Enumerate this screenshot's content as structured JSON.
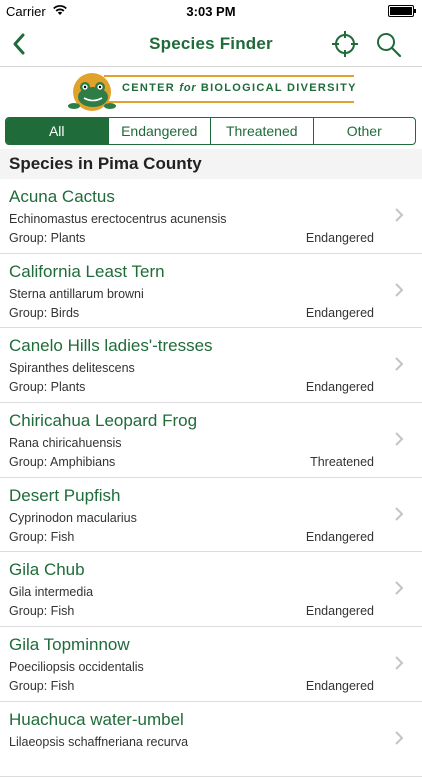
{
  "status_bar": {
    "carrier": "Carrier",
    "time": "3:03 PM"
  },
  "nav": {
    "title": "Species Finder"
  },
  "logo": {
    "text_prefix": "CENTER",
    "text_for": "for",
    "text_suffix": "BIOLOGICAL DIVERSITY"
  },
  "filter": {
    "options": [
      "All",
      "Endangered",
      "Threatened",
      "Other"
    ],
    "selected": "All"
  },
  "section": {
    "title": "Species in Pima County"
  },
  "species": [
    {
      "name": "Acuna Cactus",
      "scientific": "Echinomastus erectocentrus acunensis",
      "group": "Group: Plants",
      "status": "Endangered"
    },
    {
      "name": "California Least Tern",
      "scientific": "Sterna antillarum browni",
      "group": "Group: Birds",
      "status": "Endangered"
    },
    {
      "name": "Canelo Hills ladies'-tresses",
      "scientific": "Spiranthes delitescens",
      "group": "Group: Plants",
      "status": "Endangered"
    },
    {
      "name": "Chiricahua Leopard Frog",
      "scientific": "Rana chiricahuensis",
      "group": "Group: Amphibians",
      "status": "Threatened"
    },
    {
      "name": "Desert Pupfish",
      "scientific": "Cyprinodon macularius",
      "group": "Group: Fish",
      "status": "Endangered"
    },
    {
      "name": "Gila Chub",
      "scientific": "Gila intermedia",
      "group": "Group: Fish",
      "status": "Endangered"
    },
    {
      "name": "Gila Topminnow",
      "scientific": "Poeciliopsis occidentalis",
      "group": "Group: Fish",
      "status": "Endangered"
    },
    {
      "name": "Huachuca water-umbel",
      "scientific": "Lilaeopsis schaffneriana recurva",
      "group": "",
      "status": ""
    }
  ],
  "colors": {
    "brand_green": "#1f6b3a",
    "logo_gold": "#e0a22a",
    "section_bg": "#f4f4f4"
  },
  "icons": {
    "back": "chevron-left-icon",
    "locate": "crosshair-icon",
    "search": "search-icon",
    "row": "chevron-right-icon"
  }
}
